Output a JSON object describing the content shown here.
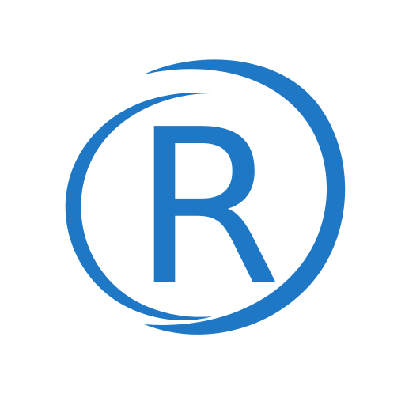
{
  "logo": {
    "icon": "registered-trademark-icon",
    "letter": "R",
    "color": "#1f78c6",
    "background": "#ffffff"
  }
}
